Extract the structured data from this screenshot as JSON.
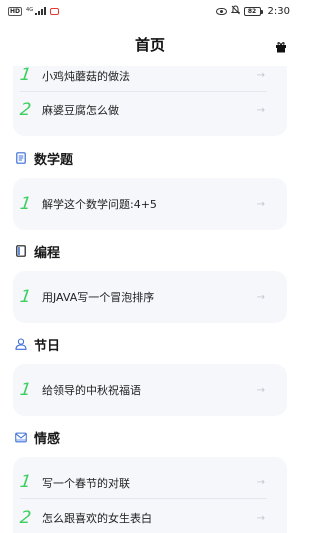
{
  "status_bar": {
    "hd": "HD",
    "network": "4G",
    "battery": "82",
    "time": "2:30"
  },
  "header": {
    "title": "首页",
    "icon": "gift-icon"
  },
  "top_card": {
    "items": [
      {
        "num": "1",
        "text": "小鸡炖蘑菇的做法"
      },
      {
        "num": "2",
        "text": "麻婆豆腐怎么做"
      }
    ]
  },
  "sections": [
    {
      "title": "数学题",
      "icon": "document-icon",
      "items": [
        {
          "num": "1",
          "text": "解学这个数学问题:4+5"
        }
      ]
    },
    {
      "title": "编程",
      "icon": "code-icon",
      "items": [
        {
          "num": "1",
          "text": "用JAVA写一个冒泡排序"
        }
      ]
    },
    {
      "title": "节日",
      "icon": "person-icon",
      "items": [
        {
          "num": "1",
          "text": "给领导的中秋祝福语"
        }
      ]
    },
    {
      "title": "情感",
      "icon": "envelope-icon",
      "items": [
        {
          "num": "1",
          "text": "写一个春节的对联"
        },
        {
          "num": "2",
          "text": "怎么跟喜欢的女生表白"
        }
      ]
    }
  ],
  "colors": {
    "accent_green": "#3ccf5f",
    "card_bg": "#f5f7fb",
    "icon_blue": "#3b6fd8"
  }
}
